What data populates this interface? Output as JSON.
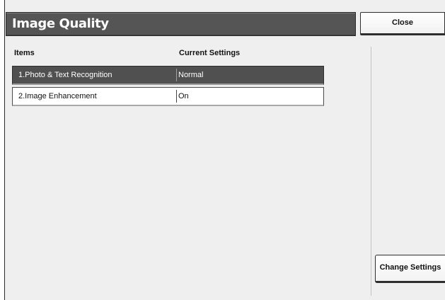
{
  "header": {
    "title": "Image Quality",
    "close_label": "Close"
  },
  "table": {
    "columns": [
      "Items",
      "Current Settings"
    ],
    "rows": [
      {
        "name": "1.Photo & Text Recognition",
        "value": "Normal",
        "selected": true
      },
      {
        "name": "2.Image Enhancement",
        "value": "On",
        "selected": false
      }
    ]
  },
  "actions": {
    "change_settings_label": "Change Settings"
  },
  "colors": {
    "title_bar": "#555555",
    "selected_row": "#505050",
    "background": "#efefef"
  }
}
